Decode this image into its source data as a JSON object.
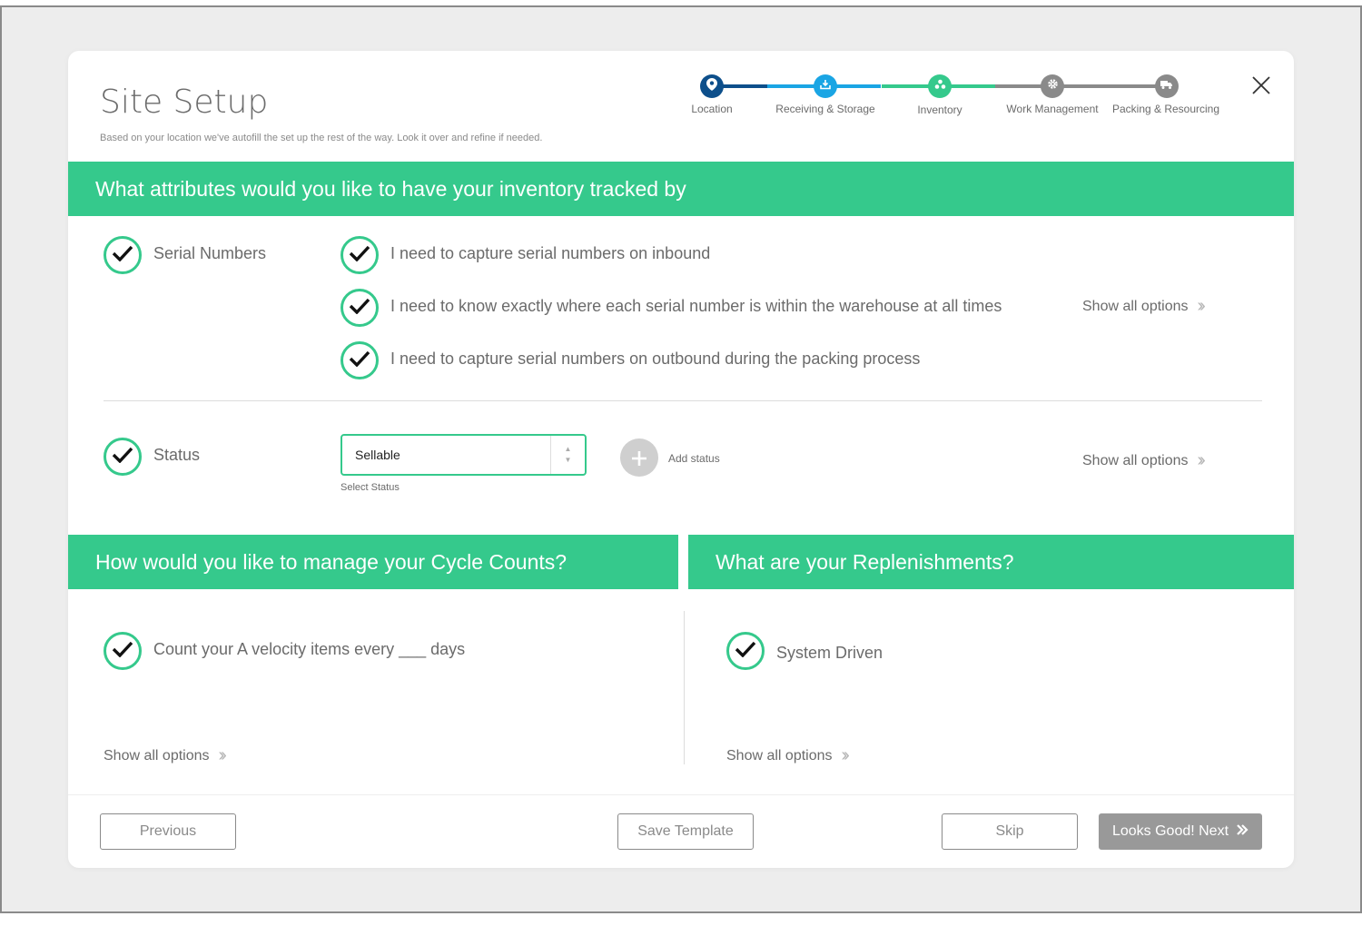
{
  "header": {
    "title": "Site Setup",
    "subtitle": "Based on your location we've autofill the set up the rest of the way. Look it over and refine if needed."
  },
  "stepper": {
    "steps": [
      {
        "label": "Location",
        "icon": "location-pin-icon",
        "color": "#0d4f8b"
      },
      {
        "label": "Receiving & Storage",
        "icon": "download-icon",
        "color": "#1aa5e4"
      },
      {
        "label": "Inventory",
        "icon": "boxes-icon",
        "color": "#35c98c"
      },
      {
        "label": "Work Management",
        "icon": "gear-icon",
        "color": "#8a8a8a"
      },
      {
        "label": "Packing & Resourcing",
        "icon": "truck-icon",
        "color": "#8a8a8a"
      }
    ]
  },
  "attributes": {
    "heading": "What attributes would you like to have your inventory tracked by",
    "serial": {
      "label": "Serial Numbers",
      "options": [
        "I need to capture serial numbers on inbound",
        "I need to know exactly where each serial number is within the warehouse at all times",
        "I need to capture serial numbers on outbound during the packing process"
      ],
      "show_all": "Show all options"
    },
    "status": {
      "label": "Status",
      "select_value": "Sellable",
      "select_caption": "Select Status",
      "add_label": "Add status",
      "show_all": "Show all options"
    }
  },
  "cycle_counts": {
    "heading": "How would you like to manage your Cycle Counts?",
    "option": "Count your A velocity items every ___ days",
    "show_all": "Show all options"
  },
  "replenishments": {
    "heading": "What are your Replenishments?",
    "option": "System Driven",
    "show_all": "Show all options"
  },
  "footer": {
    "previous": "Previous",
    "save_template": "Save Template",
    "skip": "Skip",
    "next": "Looks Good! Next"
  },
  "colors": {
    "accent": "#35c98c",
    "primary_button": "#999999"
  }
}
